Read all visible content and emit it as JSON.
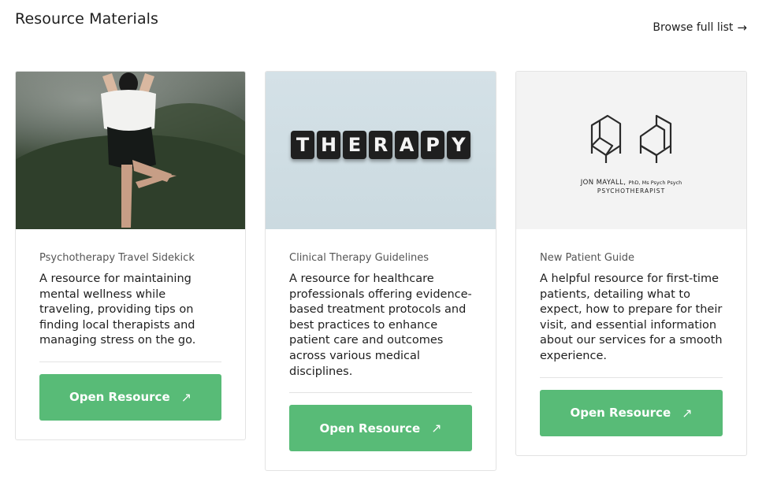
{
  "header": {
    "title": "Resource Materials",
    "browse_label": "Browse full list",
    "browse_icon": "→"
  },
  "cards": [
    {
      "category": "Psychotherapy Travel Sidekick",
      "description": "A resource for maintaining mental wellness while traveling, providing tips on finding local therapists and managing stress on the go.",
      "button_label": "Open Resource",
      "button_icon": "↗",
      "image": "woman-yoga-mountain-photo"
    },
    {
      "category": "Clinical Therapy Guidelines",
      "description": "A resource for healthcare professionals offering evidence-based treatment protocols and best practices to enhance patient care and outcomes across various medical disciplines.",
      "button_label": "Open Resource",
      "button_icon": "↗",
      "image": "therapy-letter-tiles-photo",
      "image_text": [
        "T",
        "H",
        "E",
        "R",
        "A",
        "P",
        "Y"
      ]
    },
    {
      "category": "New Patient Guide",
      "description": "A helpful resource for first-time patients, detailing what to expect, how to prepare for their visit, and essential information about our services for a smooth experience.",
      "button_label": "Open Resource",
      "button_icon": "↗",
      "image": "therapist-logo",
      "logo_name": "JON MAYALL,",
      "logo_credentials": "PhD, Ms Psych Psych",
      "logo_role": "PSYCHOTHERAPIST"
    }
  ],
  "colors": {
    "accent": "#58bb77",
    "border": "#e3e3e3"
  }
}
